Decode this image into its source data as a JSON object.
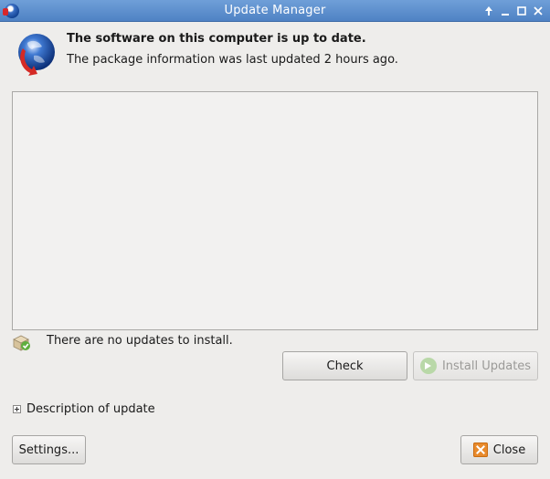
{
  "window": {
    "title": "Update Manager",
    "controls": [
      "pin-icon",
      "minimize-icon",
      "maximize-icon",
      "close-icon"
    ]
  },
  "header": {
    "icon": "globe-update-icon",
    "heading": "The software on this computer is up to date.",
    "subheading": "The package information was last updated 2 hours ago."
  },
  "update_list": {
    "items": []
  },
  "status": {
    "icon": "package-ok-icon",
    "text": "There are no updates to install."
  },
  "buttons": {
    "check": "Check",
    "install": "Install Updates",
    "settings": "Settings...",
    "close": "Close"
  },
  "description": {
    "label": "Description of update",
    "expanded": false
  },
  "colors": {
    "titlebar": "#5b8dcc",
    "window_bg": "#eeedeb",
    "close_icon": "#e88a2c"
  }
}
